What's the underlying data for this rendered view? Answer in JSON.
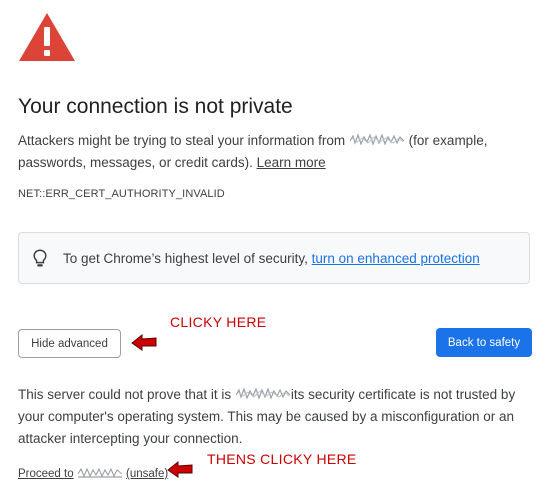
{
  "icons": {
    "warning": "warning-triangle-icon",
    "bulb": "lightbulb-icon",
    "annotation_arrow": "red-arrow-icon",
    "obscured": "scribble-redaction"
  },
  "colors": {
    "warning_red": "#db4437",
    "primary_blue": "#1a73e8",
    "annotation_red": "#cc0000"
  },
  "header": {
    "title": "Your connection is not private"
  },
  "intro": {
    "prefix": "Attackers might be trying to steal your information from",
    "suffix": "(for example, passwords, messages, or credit cards).",
    "learn_more": "Learn more"
  },
  "error_code": "NET::ERR_CERT_AUTHORITY_INVALID",
  "protection": {
    "text": "To get Chrome’s highest level of security,",
    "link": "turn on enhanced protection"
  },
  "buttons": {
    "hide_advanced": "Hide advanced",
    "back_to_safety": "Back to safety"
  },
  "annotations": {
    "first": "CLICKY HERE",
    "second": "THENS CLICKY HERE"
  },
  "details": {
    "prefix": "This server could not prove that it is",
    "suffix": "its security certificate is not trusted by your computer's operating system. This may be caused by a misconfiguration or an attacker intercepting your connection."
  },
  "proceed": {
    "prefix": "Proceed to",
    "suffix": "(unsafe)"
  }
}
